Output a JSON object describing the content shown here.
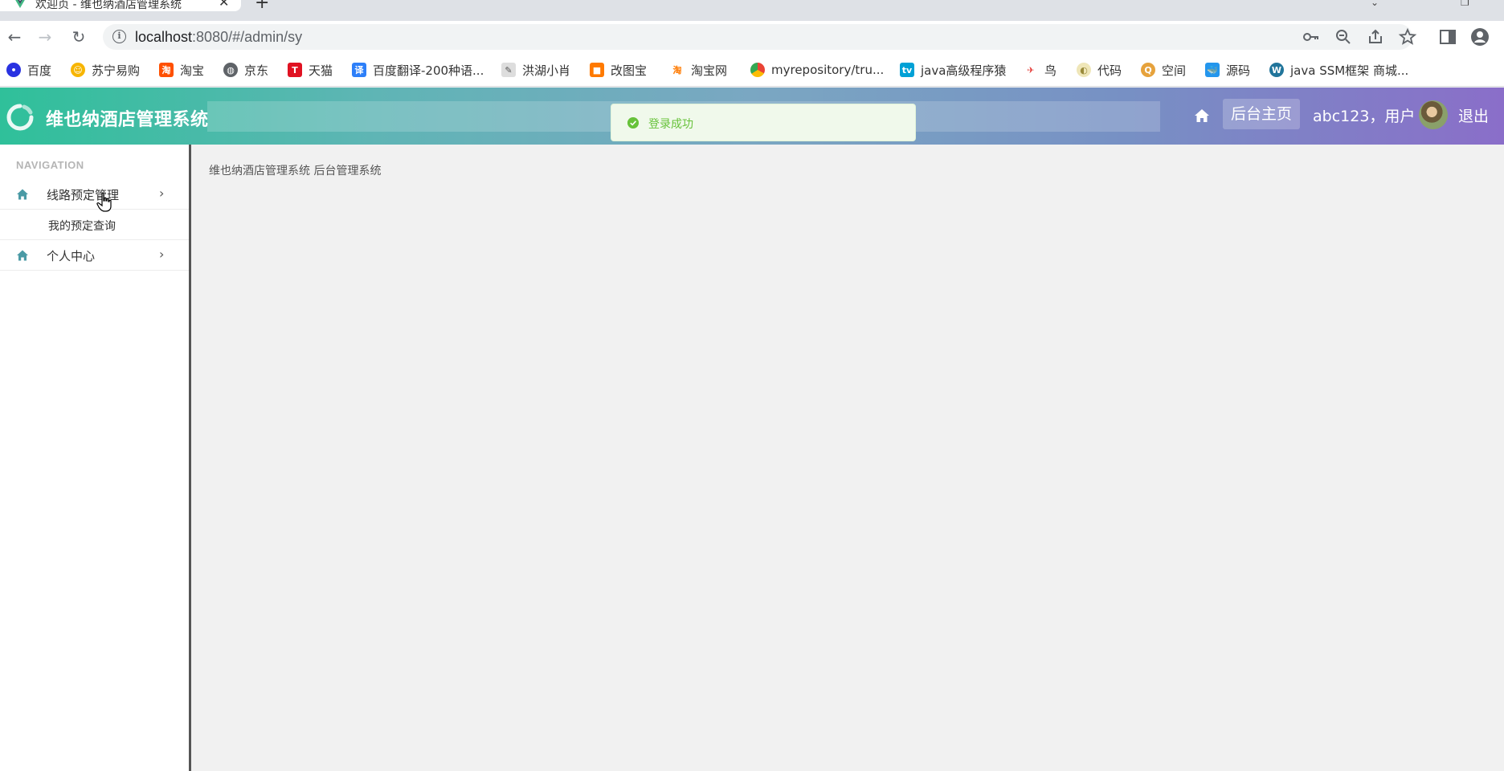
{
  "browser": {
    "tab_title": "欢迎页 - 维也纳酒店管理系统",
    "url_host": "localhost",
    "url_rest": ":8080/#/admin/sy",
    "bookmarks": [
      {
        "label": "百度",
        "icon": "baidu-icon",
        "color": "#2932e1"
      },
      {
        "label": "苏宁易购",
        "icon": "suning-icon",
        "color": "#f7b500"
      },
      {
        "label": "淘宝",
        "icon": "taobao-icon",
        "color": "#ff5000"
      },
      {
        "label": "京东",
        "icon": "globe-icon",
        "color": "#5f6368"
      },
      {
        "label": "天猫",
        "icon": "tmall-icon",
        "color": "#e01222"
      },
      {
        "label": "百度翻译-200种语...",
        "icon": "translate-icon",
        "color": "#2d7ff9"
      },
      {
        "label": "洪湖小肖",
        "icon": "bird-icon",
        "color": "#8a8a8a"
      },
      {
        "label": "改图宝",
        "icon": "gaitubao-icon",
        "color": "#ff7a00"
      },
      {
        "label": "淘宝网",
        "icon": "taobao-icon",
        "color": "#ff7a00"
      },
      {
        "label": "myrepository/tru...",
        "icon": "chrome-icon",
        "color": "#4285f4"
      },
      {
        "label": "java高级程序猿",
        "icon": "bilibili-icon",
        "color": "#00a1d6"
      },
      {
        "label": "鸟",
        "icon": "bird-icon",
        "color": "#e53935"
      },
      {
        "label": "代码",
        "icon": "code-icon",
        "color": "#c7b36a"
      },
      {
        "label": "空间",
        "icon": "qzone-icon",
        "color": "#e6a23c"
      },
      {
        "label": "源码",
        "icon": "docker-icon",
        "color": "#2496ed"
      },
      {
        "label": "java SSM框架 商城...",
        "icon": "wordpress-icon",
        "color": "#21759b"
      }
    ]
  },
  "header": {
    "title": "维也纳酒店管理系统",
    "admin_home": "后台主页",
    "user_text": "abc123，用户",
    "logout": "退出"
  },
  "toast": {
    "message": "登录成功"
  },
  "sidebar": {
    "heading": "NAVIGATION",
    "items": [
      {
        "label": "线路预定管理",
        "children": [
          "我的预定查询"
        ]
      },
      {
        "label": "个人中心",
        "children": []
      }
    ]
  },
  "main": {
    "welcome": "维也纳酒店管理系统 后台管理系统"
  },
  "colors": {
    "accent_start": "#2fc09a",
    "accent_end": "#8a6ec9",
    "toast_green": "#67c23a"
  }
}
